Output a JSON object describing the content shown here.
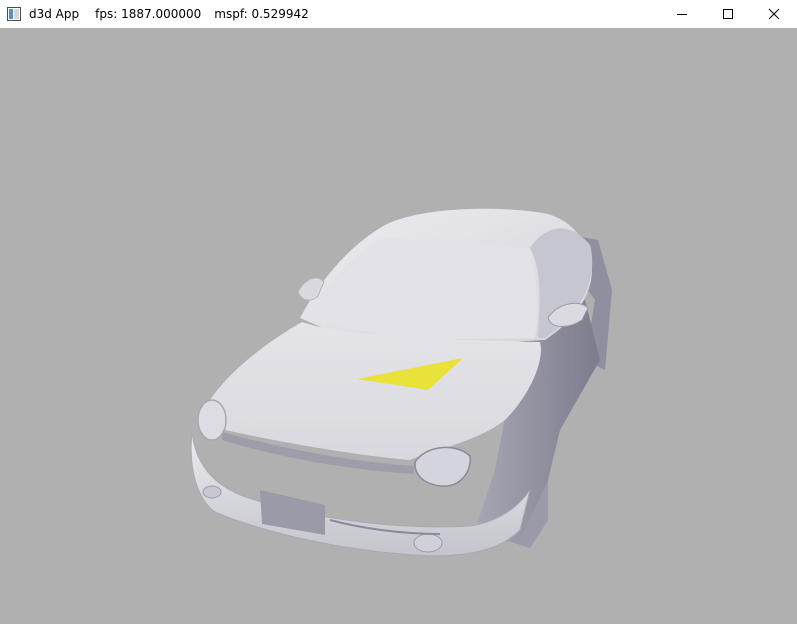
{
  "window": {
    "app_title": "d3d App",
    "fps_label": "fps: 1887.000000",
    "mspf_label": "mspf: 0.529942"
  },
  "viewport": {
    "background_color": "#b0b0b0",
    "highlight_color": "#e8e23a"
  },
  "icons": {
    "app": "window-app-icon",
    "minimize": "minimize-icon",
    "maximize": "maximize-icon",
    "close": "close-icon"
  }
}
